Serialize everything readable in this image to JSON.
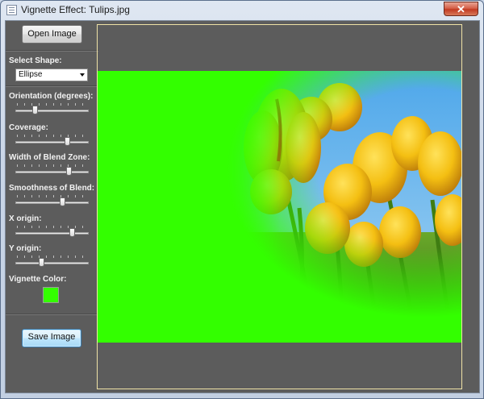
{
  "window": {
    "title": "Vignette Effect: Tulips.jpg",
    "close_glyph": "✕"
  },
  "sidebar": {
    "open_button": "Open Image",
    "select_shape_label": "Select Shape:",
    "shape_value": "Ellipse",
    "sliders": [
      {
        "label": "Orientation (degrees):",
        "value_fraction": 0.25
      },
      {
        "label": "Coverage:",
        "value_fraction": 0.73
      },
      {
        "label": "Width of Blend Zone:",
        "value_fraction": 0.76
      },
      {
        "label": "Smoothness of Blend:",
        "value_fraction": 0.66
      },
      {
        "label": "X origin:",
        "value_fraction": 0.81
      },
      {
        "label": "Y origin:",
        "value_fraction": 0.35
      }
    ],
    "vignette_color_label": "Vignette Color:",
    "save_button": "Save Image"
  },
  "colors": {
    "vignette": "#33ff00",
    "sky": "#62b4ec",
    "tulip_yellow": "#f6c410",
    "tulip_shadow": "#c88a06",
    "stem_green": "#4a8a12",
    "canvas_border": "#efe2a6",
    "client_bg": "#5c5c5c"
  },
  "image": {
    "subject": "yellow tulips against blue sky with green ellipse vignette"
  }
}
